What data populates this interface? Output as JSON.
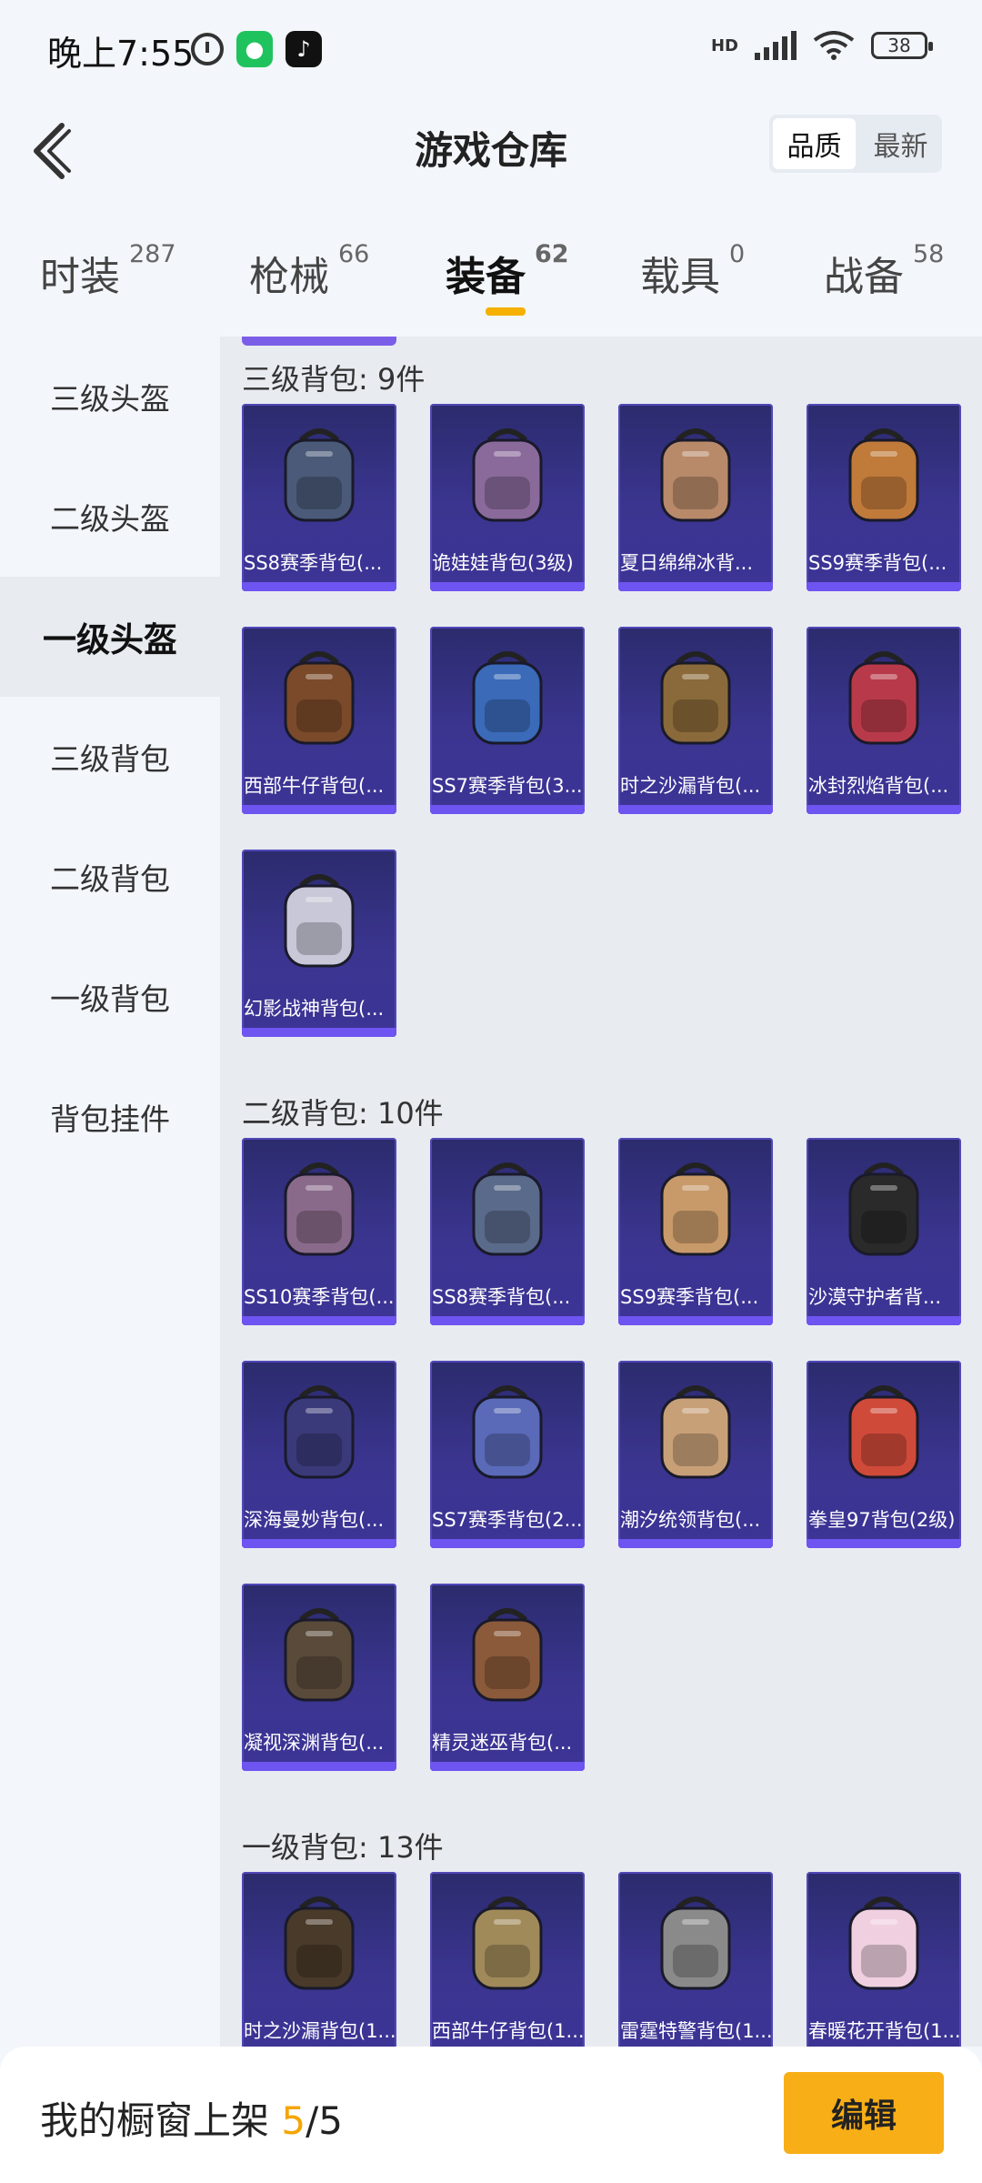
{
  "status": {
    "time": "晚上7:55",
    "hd": "HD",
    "battery": "38"
  },
  "header": {
    "title": "游戏仓库",
    "sort_options": [
      "品质",
      "最新"
    ]
  },
  "tabs": [
    {
      "label": "时装",
      "count": "287"
    },
    {
      "label": "枪械",
      "count": "66"
    },
    {
      "label": "装备",
      "count": "62"
    },
    {
      "label": "载具",
      "count": "0"
    },
    {
      "label": "战备",
      "count": "58"
    }
  ],
  "sidebar": {
    "items": [
      "三级头盔",
      "二级头盔",
      "一级头盔",
      "三级背包",
      "二级背包",
      "一级背包",
      "背包挂件"
    ]
  },
  "sections": [
    {
      "title": "三级背包: 9件",
      "items": [
        "SS8赛季背包(...",
        "诡娃娃背包(3级)",
        "夏日绵绵冰背...",
        "SS9赛季背包(...",
        "西部牛仔背包(...",
        "SS7赛季背包(3...",
        "时之沙漏背包(...",
        "冰封烈焰背包(...",
        "幻影战神背包(..."
      ]
    },
    {
      "title": "二级背包: 10件",
      "items": [
        "SS10赛季背包(...",
        "SS8赛季背包(...",
        "SS9赛季背包(...",
        "沙漠守护者背...",
        "深海曼妙背包(...",
        "SS7赛季背包(2...",
        "潮汐统领背包(...",
        "拳皇97背包(2级)",
        "凝视深渊背包(...",
        "精灵迷巫背包(..."
      ]
    },
    {
      "title": "一级背包: 13件",
      "items": [
        "时之沙漏背包(1...",
        "西部牛仔背包(1...",
        "雷霆特警背包(1...",
        "春暖花开背包(1..."
      ]
    }
  ],
  "bottom": {
    "label": "我的橱窗上架",
    "count_current": "5",
    "count_total": "/5",
    "edit_label": "编辑"
  },
  "colors": {
    "accent": "#f5b000",
    "card_bg": "#3b3590",
    "card_bar": "#6e54f0"
  }
}
